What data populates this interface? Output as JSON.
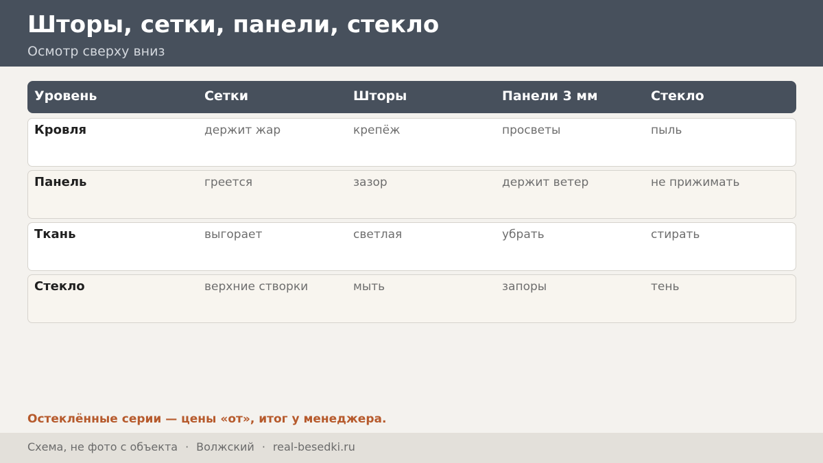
{
  "header": {
    "title": "Шторы, сетки, панели, стекло",
    "subtitle": "Осмотр сверху вниз"
  },
  "table": {
    "columns": [
      "Уровень",
      "Сетки",
      "Шторы",
      "Панели 3 мм",
      "Стекло"
    ],
    "rows": [
      {
        "level": "Кровля",
        "cells": [
          "держит жар",
          "крепёж",
          "просветы",
          "пыль"
        ]
      },
      {
        "level": "Панель",
        "cells": [
          "греется",
          "зазор",
          "держит ветер",
          "не прижимать"
        ]
      },
      {
        "level": "Ткань",
        "cells": [
          "выгорает",
          "светлая",
          "убрать",
          "стирать"
        ]
      },
      {
        "level": "Стекло",
        "cells": [
          "верхние створки",
          "мыть",
          "запоры",
          "тень"
        ]
      }
    ]
  },
  "note": "Остеклённые серии — цены «от», итог у менеджера.",
  "footer": {
    "items": [
      "Схема, не фото с объекта",
      "Волжский",
      "real-besedki.ru"
    ],
    "separator": "·"
  },
  "colors": {
    "header_bg": "#47505c",
    "accent": "#b65a2c",
    "page_bg": "#f4f2ee"
  }
}
